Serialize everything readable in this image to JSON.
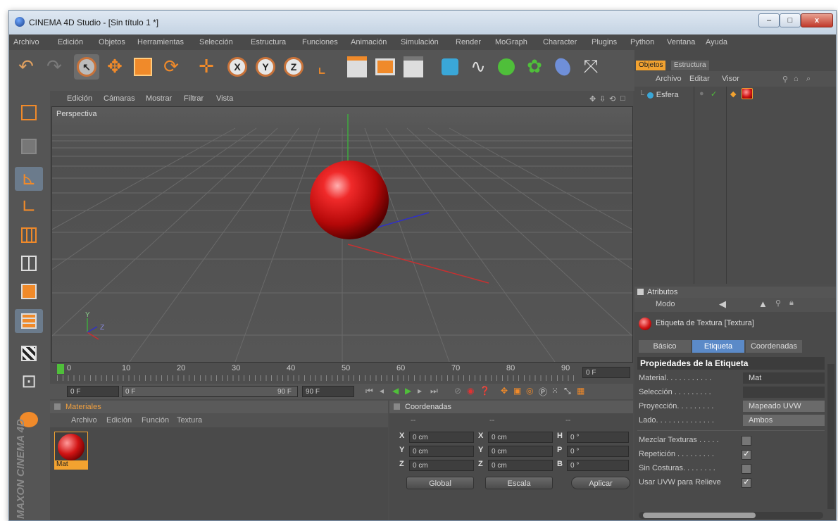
{
  "window": {
    "title": "CINEMA 4D Studio - [Sin título 1 *]",
    "controls": {
      "minimize": "–",
      "maximize": "□",
      "close": "x"
    }
  },
  "menubar": [
    "Archivo",
    "Edición",
    "Objetos",
    "Herramientas",
    "Selección",
    "Estructura",
    "Funciones",
    "Animación",
    "Simulación",
    "Render",
    "MoGraph",
    "Character",
    "Plugins",
    "Python",
    "Ventana",
    "Ayuda"
  ],
  "toolbar": {
    "icons": [
      "undo-icon",
      "redo-icon",
      "live-selection-icon",
      "move-icon",
      "scale-icon",
      "rotate-icon",
      "add-object-icon",
      "x-axis-lock-icon",
      "y-axis-lock-icon",
      "z-axis-lock-icon",
      "coordinate-system-icon",
      "render-view-icon",
      "render-picture-viewer-icon",
      "render-settings-icon",
      "cube-primitive-icon",
      "spline-pen-icon",
      "nurbs-icon",
      "array-icon",
      "deformer-icon",
      "camera-icon"
    ],
    "axis_labels": [
      "X",
      "Y",
      "Z"
    ]
  },
  "viewport": {
    "menu": [
      "Edición",
      "Cámaras",
      "Mostrar",
      "Filtrar",
      "Vista"
    ],
    "camera_label": "Perspectiva",
    "axis_gizmo": {
      "y": "Y",
      "z": "Z"
    }
  },
  "timeline": {
    "ticks": [
      "0",
      "10",
      "20",
      "30",
      "40",
      "50",
      "60",
      "70",
      "80",
      "90"
    ],
    "current_frame": "0 F"
  },
  "controls_bar": {
    "start": "0 F",
    "range_start": "0 F",
    "range_end": "90 F",
    "end": "90 F"
  },
  "materials": {
    "title": "Materiales",
    "menu": [
      "Archivo",
      "Edición",
      "Función",
      "Textura"
    ],
    "items": [
      {
        "name": "Mat"
      }
    ]
  },
  "coordinates": {
    "title": "Coordenadas",
    "col_headers": [
      "--",
      "--",
      "--"
    ],
    "rows": [
      {
        "p": "X",
        "pv": "0 cm",
        "s": "X",
        "sv": "0 cm",
        "r": "H",
        "rv": "0 °"
      },
      {
        "p": "Y",
        "pv": "0 cm",
        "s": "Y",
        "sv": "0 cm",
        "r": "P",
        "rv": "0 °"
      },
      {
        "p": "Z",
        "pv": "0 cm",
        "s": "Z",
        "sv": "0 cm",
        "r": "B",
        "rv": "0 °"
      }
    ],
    "mode_select": "Global",
    "scale_select": "Escala",
    "apply": "Aplicar"
  },
  "objects_panel": {
    "tabs": [
      "Objetos",
      "Estructura"
    ],
    "menu": [
      "Archivo",
      "Editar",
      "Visor"
    ],
    "items": [
      {
        "name": "Esfera"
      }
    ]
  },
  "attributes": {
    "title": "Atributos",
    "mode": "Modo",
    "selected_title": "Etiqueta de Textura [Textura]",
    "tabs": [
      "Básico",
      "Etiqueta",
      "Coordenadas"
    ],
    "active_tab": "Etiqueta",
    "section": "Propiedades de la Etiqueta",
    "props": [
      {
        "label": "Material. . . . . . . . . . .",
        "value": "Mat",
        "type": "field"
      },
      {
        "label": "Selección . . . . . . . . .",
        "value": "",
        "type": "field"
      },
      {
        "label": "Proyección. . . . . . . . .",
        "value": "Mapeado UVW",
        "type": "button"
      },
      {
        "label": "Lado. . . . . . . . . . . . . .",
        "value": "Ambos",
        "type": "button"
      },
      {
        "label": "Mezclar Texturas . . . . .",
        "checked": false,
        "type": "check"
      },
      {
        "label": "Repetición . . . . . . . . .",
        "checked": true,
        "type": "check"
      },
      {
        "label": "Sin Costuras. . . . . . . .",
        "checked": false,
        "type": "check"
      },
      {
        "label": "Usar UVW para Relieve",
        "checked": true,
        "type": "check"
      }
    ]
  },
  "branding": {
    "vertical_logo": "MAXON CINEMA 4D"
  },
  "colors": {
    "accent_orange": "#f2a230",
    "tab_blue": "#5b8ac8",
    "sphere_red": "#d11414"
  }
}
